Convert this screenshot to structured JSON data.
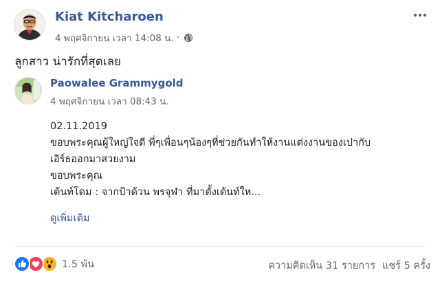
{
  "post": {
    "author": "Kiat Kitcharoen",
    "timestamp": "4 พฤศจิกายน เวลา 14:08 น.",
    "separator": "·",
    "privacy_icon": "globe-icon",
    "more_icon": "more-dots-icon",
    "text": "ลูกสาว น่ารักที่สุดเลย"
  },
  "shared": {
    "author": "Paowalee Grammygold",
    "timestamp": "4 พฤศจิกายน เวลา 08:43 น.",
    "lines": [
      "02.11.2019",
      "ขอบพระคุณผู้ใหญ่ใจดี พี่ๆเพื่อนๆน้องๆที่ช่วยกันทำให้งานแต่งงานของเปากับ",
      "เอิร์ธออกมาสวยงาม",
      "ขอบพระคุณ",
      "เต้นท์โดม : จากป้าด้วน พรจุฬา ที่มาตั้งเต้นท์ให..."
    ],
    "see_more": "ดูเพิ่มเติม"
  },
  "footer": {
    "reactions": [
      "like",
      "love",
      "wow"
    ],
    "reaction_count": "1.5 พัน",
    "comments": "ความคิดเห็น 31 รายการ",
    "shares": "แชร์ 5 ครั้ง"
  },
  "colors": {
    "link": "#385898",
    "meta": "#606770",
    "like": "#1877f2",
    "love": "#f33e58",
    "wow": "#f7b125"
  }
}
